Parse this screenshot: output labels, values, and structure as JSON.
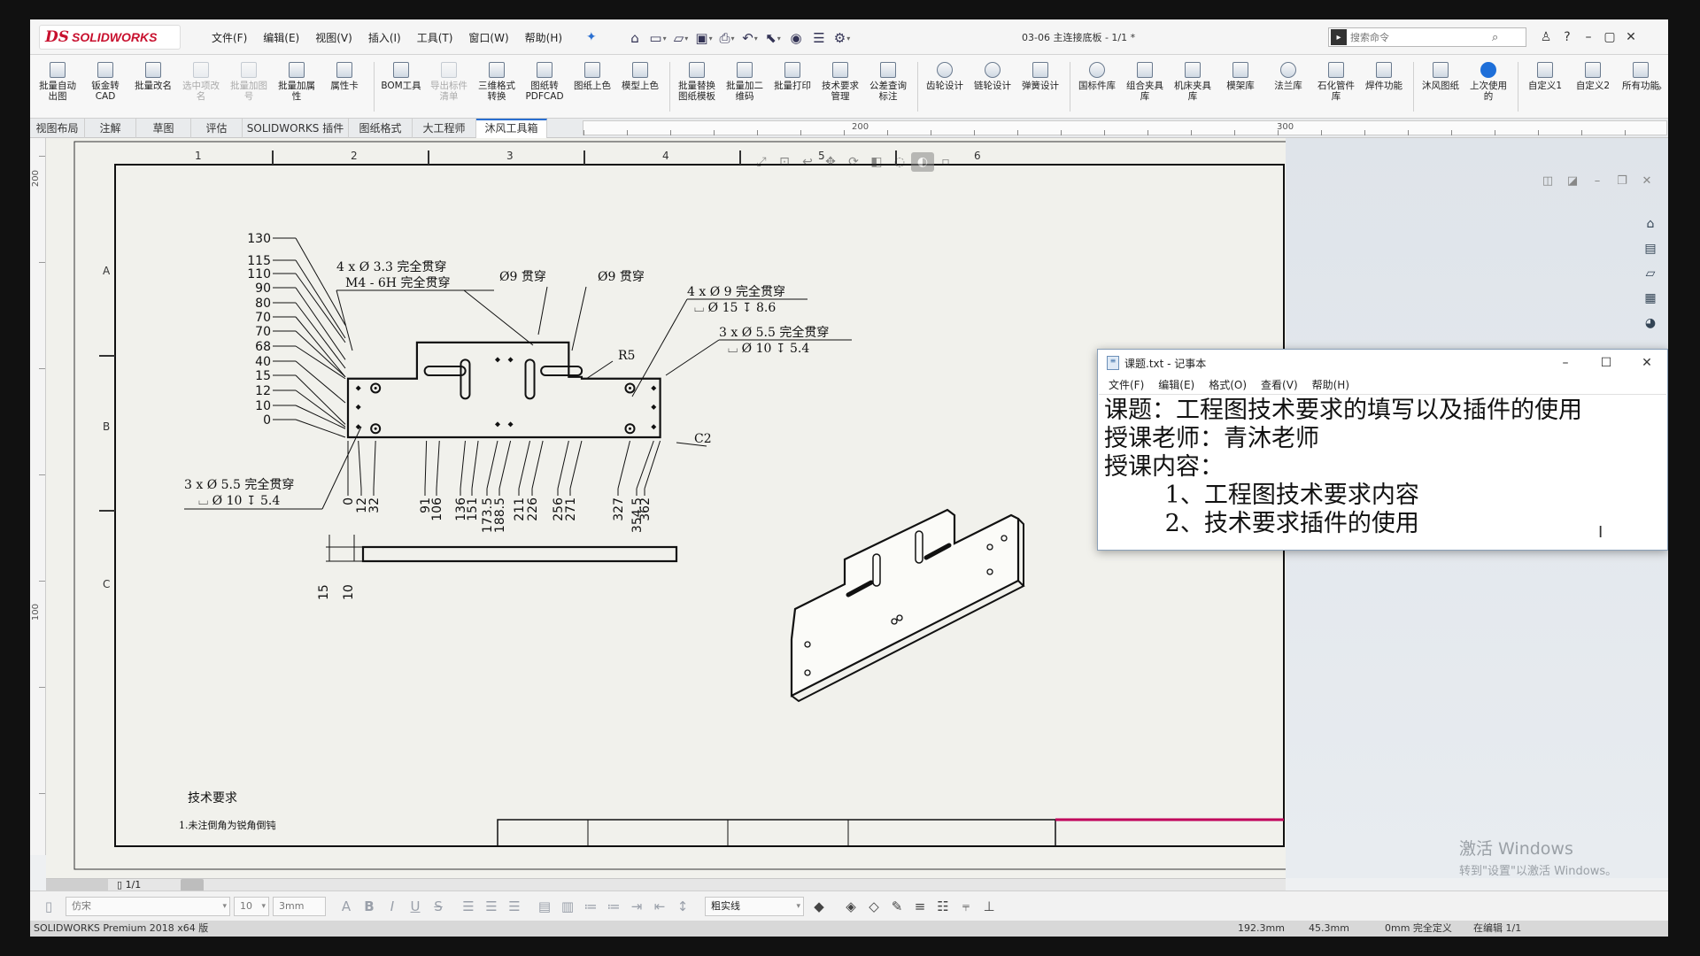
{
  "app": {
    "logo_prefix": "DS",
    "logo_name": "SOLIDWORKS",
    "document_title": "03-06 主连接底板 - 1/1 *",
    "menu": [
      "文件(F)",
      "编辑(E)",
      "视图(V)",
      "插入(I)",
      "工具(T)",
      "窗口(W)",
      "帮助(H)"
    ],
    "search_placeholder": "搜索命令"
  },
  "ribbon": [
    {
      "label": "批量自动出图",
      "icon": "batch-drawing-icon"
    },
    {
      "label": "钣金转CAD",
      "icon": "sheetmetal-icon"
    },
    {
      "label": "批量改名",
      "icon": "rename-icon"
    },
    {
      "label": "选中项改名",
      "icon": "rename-selected-icon",
      "disabled": true
    },
    {
      "label": "批量加图号",
      "icon": "add-number-icon",
      "disabled": true
    },
    {
      "label": "批量加属性",
      "icon": "add-property-icon"
    },
    {
      "label": "属性卡",
      "icon": "property-card-icon"
    },
    {
      "label": "BOM工具",
      "icon": "bom-icon"
    },
    {
      "label": "导出标件清单",
      "icon": "export-list-icon",
      "disabled": true
    },
    {
      "label": "三维格式转换",
      "icon": "format-convert-icon"
    },
    {
      "label": "图纸转PDFCAD",
      "icon": "pdf-icon"
    },
    {
      "label": "图纸上色",
      "icon": "color-drawing-icon"
    },
    {
      "label": "模型上色",
      "icon": "color-model-icon"
    },
    {
      "label": "批量替换图纸模板",
      "icon": "replace-template-icon"
    },
    {
      "label": "批量加二维码",
      "icon": "qr-icon"
    },
    {
      "label": "批量打印",
      "icon": "print-icon"
    },
    {
      "label": "技术要求管理",
      "icon": "tech-req-icon"
    },
    {
      "label": "公差查询标注",
      "icon": "tolerance-icon"
    },
    {
      "label": "齿轮设计",
      "icon": "gear-design-icon"
    },
    {
      "label": "链轮设计",
      "icon": "sprocket-icon"
    },
    {
      "label": "弹簧设计",
      "icon": "spring-icon"
    },
    {
      "label": "国标件库",
      "icon": "standard-parts-icon"
    },
    {
      "label": "组合夹具库",
      "icon": "fixture-icon"
    },
    {
      "label": "机床夹具库",
      "icon": "machine-fixture-icon"
    },
    {
      "label": "模架库",
      "icon": "mold-base-icon"
    },
    {
      "label": "法兰库",
      "icon": "flange-icon"
    },
    {
      "label": "石化管件库",
      "icon": "pipe-fitting-icon"
    },
    {
      "label": "焊件功能",
      "icon": "weldment-icon"
    },
    {
      "label": "沐风图纸",
      "icon": "mufeng-drawing-icon"
    },
    {
      "label": "上次使用的",
      "icon": "recent-icon"
    },
    {
      "label": "自定义1",
      "icon": "custom1-icon"
    },
    {
      "label": "自定义2",
      "icon": "custom2-icon"
    },
    {
      "label": "所有功能",
      "icon": "all-functions-icon"
    }
  ],
  "tabs": [
    "视图布局",
    "注解",
    "草图",
    "评估",
    "SOLIDWORKS 插件",
    "图纸格式",
    "大工程师",
    "沐风工具箱"
  ],
  "active_tab": "沐风工具箱",
  "ruler": {
    "h_labels": [
      "200",
      "300"
    ],
    "v_labels": [
      "200",
      "100"
    ]
  },
  "sheet": {
    "zone_cols": [
      "1",
      "2",
      "3",
      "4",
      "5",
      "6"
    ],
    "zone_rows": [
      "A",
      "B",
      "C"
    ],
    "y_dims": [
      "130",
      "115",
      "110",
      "90",
      "80",
      "70",
      "70",
      "68",
      "40",
      "15",
      "12",
      "10",
      "0"
    ],
    "x_dims": [
      "0",
      "12",
      "32",
      "91",
      "106",
      "136",
      "151",
      "173.5",
      "188.5",
      "211",
      "226",
      "256",
      "271",
      "327",
      "354.5",
      "362"
    ],
    "thickness_dims": [
      "15",
      "10"
    ],
    "notes": {
      "n1a": "4 x Ø 3.3 完全贯穿",
      "n1b": "M4 - 6H 完全贯穿",
      "n2": "Ø9 贯穿",
      "n3": "Ø9 贯穿",
      "n4a": "4 x Ø 9 完全贯穿",
      "n4b": "⌴ Ø 15 ↧ 8.6",
      "n5a": "3 x Ø 5.5 完全贯穿",
      "n5b": "⌴ Ø 10 ↧ 5.4",
      "n6a": "3 x Ø 5.5 完全贯穿",
      "n6b": "⌴ Ø 10 ↧ 5.4",
      "r5": "R5",
      "c2": "C2"
    },
    "tech_title": "技术要求",
    "tech_line1": "1.未注倒角为锐角倒钝"
  },
  "notepad": {
    "title": "课题.txt - 记事本",
    "menu": [
      "文件(F)",
      "编辑(E)",
      "格式(O)",
      "查看(V)",
      "帮助(H)"
    ],
    "lines": [
      "课题：工程图技术要求的填写以及插件的使用",
      "授课老师：青沐老师",
      "授课内容：",
      "        1、工程图技术要求内容",
      "        2、技术要求插件的使用"
    ]
  },
  "sheet_tab": "1/1",
  "format_bar": {
    "font": "仿宋",
    "size": "10",
    "height": "3mm",
    "line_style": "粗实线"
  },
  "watermark": {
    "line1": "激活 Windows",
    "line2": "转到\"设置\"以激活 Windows。"
  },
  "status": {
    "left": "SOLIDWORKS Premium 2018 x64 版",
    "r1": "192.3mm",
    "r2": "45.3mm",
    "r3": "0mm 完全定义",
    "r4": "在编辑 1/1"
  }
}
